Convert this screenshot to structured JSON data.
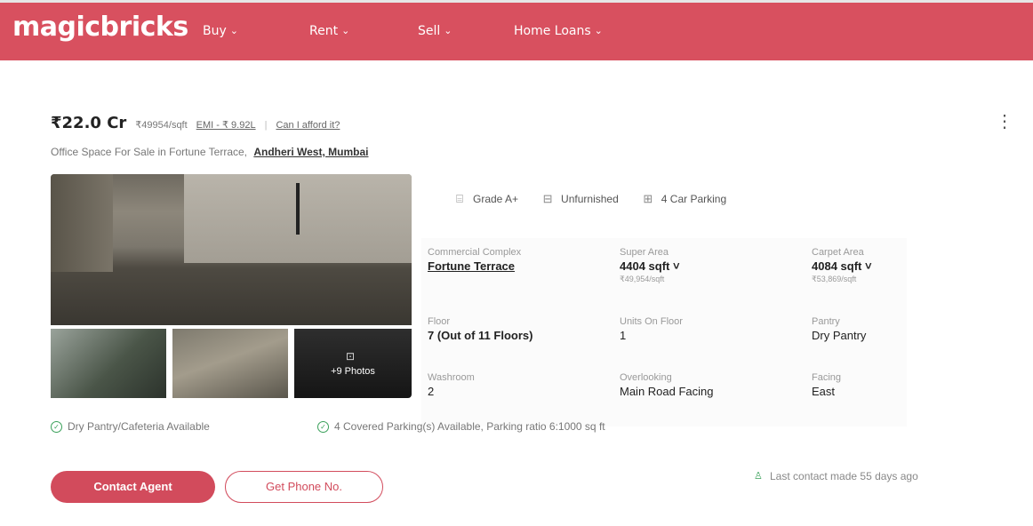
{
  "header": {
    "logo": "magicbricks",
    "nav": [
      {
        "label": "Buy"
      },
      {
        "label": "Rent"
      },
      {
        "label": "Sell"
      },
      {
        "label": "Home Loans"
      }
    ],
    "brand_color": "#d8505f"
  },
  "listing": {
    "price": "₹22.0 Cr",
    "price_per_sqft": "₹49954/sqft",
    "emi": "EMI - ₹ 9.92L",
    "separator": "|",
    "afford_link": "Can I afford it?",
    "title": "Office Space For Sale in Fortune Terrace,",
    "location": "Andheri West, Mumbai",
    "more_icon": "⋮",
    "photos": {
      "more_count": "+9 Photos",
      "photo_icon": "⊡"
    },
    "tags": [
      {
        "icon": "building-icon",
        "glyph": "⌸",
        "label": "Grade A+"
      },
      {
        "icon": "sofa-icon",
        "glyph": "⊟",
        "label": "Unfurnished"
      },
      {
        "icon": "car-icon",
        "glyph": "⊞",
        "label": "4 Car Parking"
      }
    ],
    "details": {
      "commercial_complex": {
        "label": "Commercial Complex",
        "value": "Fortune Terrace"
      },
      "super_area": {
        "label": "Super Area",
        "value": "4404 sqft ˅",
        "sub": "₹49,954/sqft"
      },
      "carpet_area": {
        "label": "Carpet Area",
        "value": "4084 sqft ˅",
        "sub": "₹53,869/sqft"
      },
      "floor": {
        "label": "Floor",
        "value": "7 (Out of 11 Floors)"
      },
      "units_on_floor": {
        "label": "Units On Floor",
        "value": "1"
      },
      "pantry": {
        "label": "Pantry",
        "value": "Dry Pantry"
      },
      "washroom": {
        "label": "Washroom",
        "value": "2"
      },
      "overlooking": {
        "label": "Overlooking",
        "value": "Main Road Facing"
      },
      "facing": {
        "label": "Facing",
        "value": "East"
      }
    },
    "amenities": [
      {
        "icon": "check-circle-icon",
        "glyph": "✓",
        "label": "Dry Pantry/Cafeteria Available"
      },
      {
        "icon": "check-circle-icon",
        "glyph": "✓",
        "label": "4 Covered Parking(s) Available, Parking ratio 6:1000 sq ft"
      }
    ],
    "actions": {
      "contact_agent": "Contact Agent",
      "get_phone": "Get Phone No."
    },
    "last_contact": {
      "icon": "person-icon",
      "glyph": "♙",
      "label": "Last contact made 55 days ago"
    }
  }
}
